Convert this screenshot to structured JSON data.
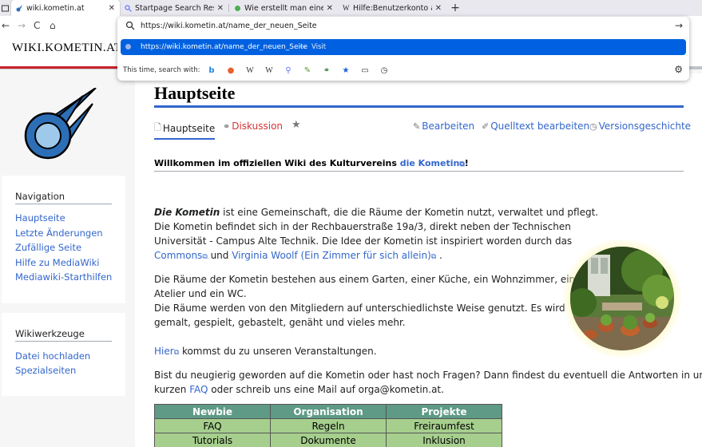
{
  "browser": {
    "tabs": [
      {
        "title": "",
        "icon": "tab-overflow-icon"
      },
      {
        "title": "wiki.kometin.at",
        "icon": "kometin-favicon",
        "active": true
      },
      {
        "title": "Startpage Search Results",
        "icon": "search-favicon"
      },
      {
        "title": "Wie erstellt man einen B",
        "icon": "leaf-favicon"
      },
      {
        "title": "Hilfe:Benutzerkonto anle",
        "icon": "wikipedia-favicon"
      }
    ],
    "close_glyph": "✕",
    "newtab_glyph": "+",
    "nav": {
      "back": "←",
      "forward": "→",
      "reload": "C",
      "home": "⌂"
    },
    "url_value": "https://wiki.kometin.at/name_der_neuen_Seite",
    "suggestion": {
      "url": "https://wiki.kometin.at/name_der_neuen_Seite",
      "separator": "—",
      "action": "Visit"
    },
    "engines_label": "This time, search with:",
    "engines": [
      {
        "name": "bing-icon",
        "glyph": "b",
        "color": "#1e88e5"
      },
      {
        "name": "duckduckgo-icon",
        "glyph": "●",
        "color": "#e8602c"
      },
      {
        "name": "wikipedia-icon",
        "glyph": "W",
        "color": "#222"
      },
      {
        "name": "wiktionary-icon",
        "glyph": "W",
        "color": "#222"
      },
      {
        "name": "startpage-icon",
        "glyph": "⚲",
        "color": "#6573ff"
      },
      {
        "name": "leaf-search-icon",
        "glyph": "✎",
        "color": "#5a9a2c"
      },
      {
        "name": "link-search-icon",
        "glyph": "⚭",
        "color": "#2e7d32"
      },
      {
        "name": "bookmarks-icon",
        "glyph": "★",
        "color": "#1a5fd1"
      },
      {
        "name": "tabs-icon",
        "glyph": "▭",
        "color": "#333"
      },
      {
        "name": "history-icon",
        "glyph": "◷",
        "color": "#333"
      }
    ],
    "settings_glyph": "⚙"
  },
  "site": {
    "title": "WIKI.KOMETIN.AT",
    "accent_red": "#c7232b",
    "link_color": "#3366cc"
  },
  "sidebar": {
    "navigation": {
      "heading": "Navigation",
      "items": [
        "Hauptseite",
        "Letzte Änderungen",
        "Zufällige Seite",
        "Hilfe zu MediaWiki",
        "Mediawiki-Starthilfen"
      ]
    },
    "tools": {
      "heading": "Wikiwerkzeuge",
      "items": [
        "Datei hochladen",
        "Spezialseiten"
      ]
    }
  },
  "page": {
    "heading": "Hauptseite",
    "tabs": {
      "main": "Hauptseite",
      "talk": "Diskussion",
      "edit": "Bearbeiten",
      "source": "Quelltext bearbeiten",
      "history": "Versionsgeschichte"
    },
    "welcome_prefix": "Willkommen im offiziellen Wiki des Kulturvereins ",
    "welcome_link": "die Kometin",
    "welcome_suffix": "!",
    "p1": {
      "bold": "Die Kometin",
      "line1": " ist eine Gemeinschaft, die die Räume der Kometin nutzt, verwaltet und pflegt.",
      "line2": "Die Kometin befindet sich in der Rechbauerstraße 19a/3, direkt neben der Technischen",
      "line3": "Universität - Campus Alte Technik. Die Idee der Kometin ist inspiriert worden durch das",
      "link1": "Commons",
      "and": " und ",
      "link2": "Virginia Woolf (Ein Zimmer für sich allein)",
      "end": " ."
    },
    "p2": {
      "line1": "Die Räume der Kometin bestehen aus einem Garten, einer Küche, ein Wohnzimmer, ein",
      "line2": "Atelier und ein WC.",
      "line3": "Die Räume werden von den Mitgliedern auf unterschiedlichste Weise genutzt. Es wird",
      "line4": "gemalt, gespielt, gebastelt, genäht und vieles mehr."
    },
    "p3": {
      "link": "Hier",
      "text": " kommst du zu unseren Veranstaltungen."
    },
    "p4": {
      "line1": "Bist du neugierig geworden auf die Kometin oder hast noch Fragen? Dann findest du eventuell die Antworten in unserem",
      "pre": "kurzen ",
      "link": "FAQ",
      "post": " oder schreib uns eine Mail auf orga@kometin.at."
    },
    "ext_glyph": "⧉",
    "table": {
      "headers": [
        "Newbie",
        "Organisation",
        "Projekte"
      ],
      "rows": [
        [
          "FAQ",
          "Regeln",
          "Freiraumfest"
        ],
        [
          "Tutorials",
          "Dokumente",
          "Inklusion"
        ]
      ]
    }
  }
}
